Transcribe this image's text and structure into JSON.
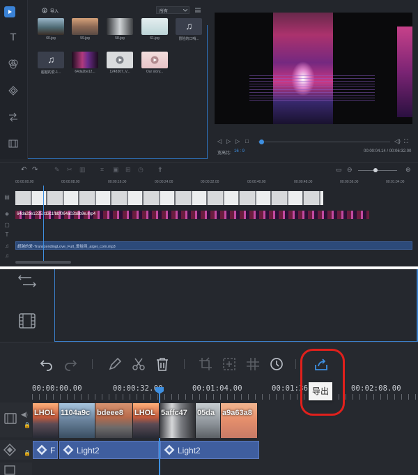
{
  "media": {
    "import_label": "导入",
    "filter_value": "所有",
    "items": [
      {
        "label": "60.jpg"
      },
      {
        "label": "59.jpg"
      },
      {
        "label": "58.jpg"
      },
      {
        "label": "61.jpg"
      },
      {
        "label": "冒险的口哨..."
      },
      {
        "label": "超越的爱-1..."
      },
      {
        "label": "64da2be12..."
      },
      {
        "label": "1248307_V..."
      },
      {
        "label": "Our story..."
      }
    ]
  },
  "preview": {
    "aspect_label": "宽高比:",
    "aspect_value": "16 : 9",
    "time_display": "00:00:04.14 / 00:06:32.00"
  },
  "top_timeline": {
    "ruler_ticks": [
      "00:00:00.00",
      "00:00:08.00",
      "00:00:16.00",
      "00:00:24.00",
      "00:00:32.00",
      "00:00:40.00",
      "00:00:48.00",
      "00:00:56.00",
      "00:01:04.00"
    ],
    "video_clip_label": "64da2be12252d3c1fbbf064a02b8b9e.mp4",
    "audio_clip_label": "超越的爱-TranscendingLove_Full_爱给网_aigei_com.mp3"
  },
  "timeline": {
    "tools": [
      "undo-icon",
      "redo-icon",
      "edit-icon",
      "cut-icon",
      "delete-icon",
      "crop-icon",
      "freeze-frame-icon",
      "mosaic-icon",
      "duration-icon",
      "export-icon"
    ],
    "ruler_ticks": [
      "00:00:00.00",
      "00:00:32.00",
      "00:01:04.00",
      "00:01:36.00",
      "00:02:08.00"
    ],
    "video_clips": [
      {
        "label": "LHOL"
      },
      {
        "label": "1104a9c"
      },
      {
        "label": "bdeee8"
      },
      {
        "label": "LHOL"
      },
      {
        "label": "5affc47"
      },
      {
        "label": "05da"
      },
      {
        "label": "a9a63a8"
      }
    ],
    "fx_clips": [
      {
        "label": "F"
      },
      {
        "label": "Light2"
      },
      {
        "label": "Light2"
      }
    ],
    "export_tooltip": "导出",
    "colors": {
      "accent": "#3e8fe0",
      "highlight_ring": "#e0201c",
      "fx_clip": "#3f5e9f"
    }
  }
}
